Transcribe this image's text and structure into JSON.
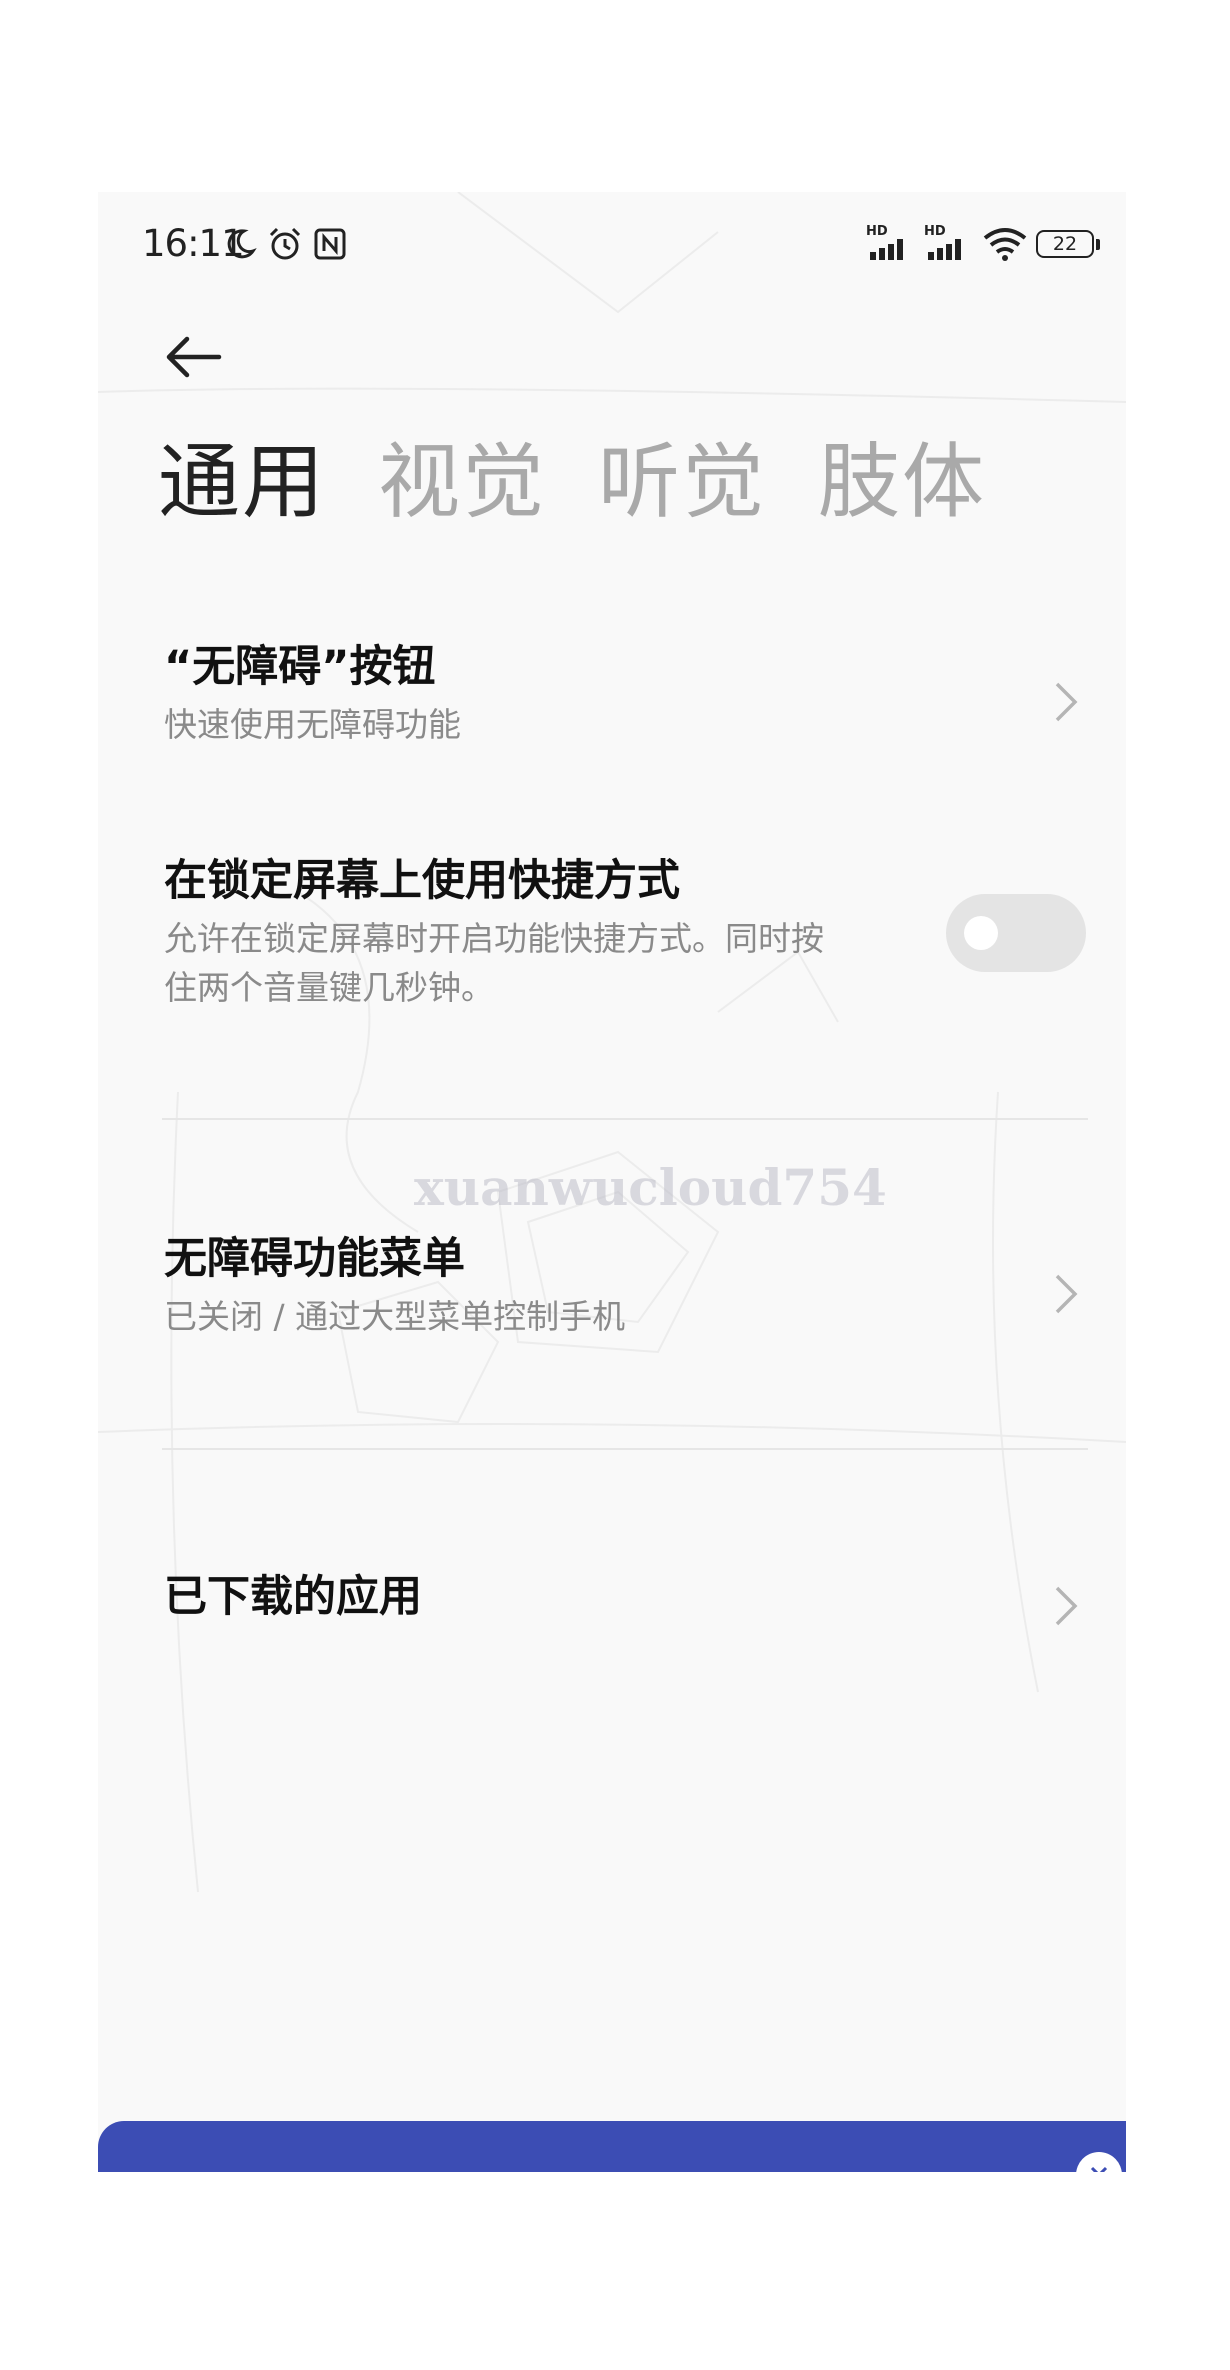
{
  "status_bar": {
    "time": "16:11",
    "left_icons": [
      "moon-icon",
      "alarm-icon",
      "nfc-icon"
    ],
    "signal_1_label": "HD",
    "signal_2_label": "HD",
    "battery_level": "22"
  },
  "header": {
    "back_icon": "arrow-left-icon"
  },
  "tabs": [
    {
      "label": "通用",
      "active": true
    },
    {
      "label": "视觉",
      "active": false
    },
    {
      "label": "听觉",
      "active": false
    },
    {
      "label": "肢体",
      "active": false
    }
  ],
  "items": [
    {
      "title": "“无障碍”按钮",
      "subtitle": "快速使用无障碍功能",
      "control": "chevron"
    },
    {
      "title": "在锁定屏幕上使用快捷方式",
      "subtitle_line1": "允许在锁定屏幕时开启功能快捷方式。同时按",
      "subtitle_line2": "住两个音量键几秒钟。",
      "control": "toggle",
      "toggle_on": false
    },
    {
      "title": "无障碍功能菜单",
      "subtitle": "已关闭 / 通过大型菜单控制手机",
      "control": "chevron"
    },
    {
      "title": "已下载的应用",
      "control": "chevron"
    }
  ],
  "watermark": "xuanwucloud754",
  "colors": {
    "banner": "#3c4db4",
    "toggle_off": "#e4e4e4",
    "active_tab": "#222222",
    "inactive_tab": "#a9a9a9"
  }
}
